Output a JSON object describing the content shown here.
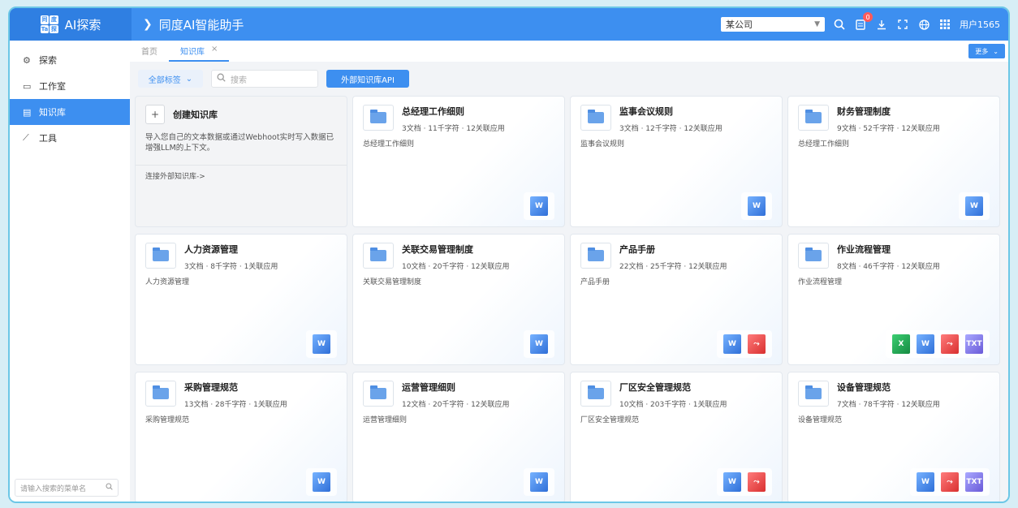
{
  "header": {
    "brand": "AI探索",
    "breadcrumb": "同度AI智能助手",
    "company": "某公司",
    "notification_count": "0",
    "user": "用户1565",
    "icons": [
      "search-icon",
      "notification-icon",
      "download-icon",
      "fullscreen-icon",
      "globe-icon",
      "grid-icon"
    ]
  },
  "sidebar": {
    "items": [
      {
        "label": "探索",
        "icon": "explore-icon"
      },
      {
        "label": "工作室",
        "icon": "monitor-icon"
      },
      {
        "label": "知识库",
        "icon": "book-icon"
      },
      {
        "label": "工具",
        "icon": "tool-icon"
      }
    ],
    "search_placeholder": "请输入搜索的菜单名"
  },
  "tabs": {
    "home": "首页",
    "active": "知识库",
    "more": "更多"
  },
  "toolbar": {
    "tag_filter": "全部标签",
    "search_placeholder": "搜索",
    "api_button": "外部知识库API"
  },
  "create_card": {
    "title": "创建知识库",
    "description": "导入您自己的文本数据或通过Webhoot实时写入数据已增强LLM的上下文。",
    "link": "连接外部知识库->"
  },
  "cards": [
    {
      "title": "总经理工作细则",
      "meta": "3文档 · 11千字符 · 12关联应用",
      "desc": "总经理工作细则",
      "files": [
        "word"
      ]
    },
    {
      "title": "监事会议规则",
      "meta": "3文档 · 12千字符 · 12关联应用",
      "desc": "监事会议规则",
      "files": [
        "word"
      ]
    },
    {
      "title": "财务管理制度",
      "meta": "9文档 · 52千字符 · 12关联应用",
      "desc": "总经理工作细则",
      "files": [
        "word"
      ]
    },
    {
      "title": "人力资源管理",
      "meta": "3文档 · 8千字符 · 1关联应用",
      "desc": "人力资源管理",
      "files": [
        "word"
      ]
    },
    {
      "title": "关联交易管理制度",
      "meta": "10文档 · 20千字符 · 12关联应用",
      "desc": "关联交易管理制度",
      "files": [
        "word"
      ]
    },
    {
      "title": "产品手册",
      "meta": "22文档 · 25千字符 · 12关联应用",
      "desc": "产品手册",
      "files": [
        "word",
        "pdf"
      ]
    },
    {
      "title": "作业流程管理",
      "meta": "8文档 · 46千字符 · 12关联应用",
      "desc": "作业流程管理",
      "files": [
        "excel",
        "word",
        "pdf",
        "txt"
      ]
    },
    {
      "title": "采购管理规范",
      "meta": "13文档 · 28千字符 · 1关联应用",
      "desc": "采购管理规范",
      "files": [
        "word"
      ]
    },
    {
      "title": "运营管理细则",
      "meta": "12文档 · 20千字符 · 12关联应用",
      "desc": "运营管理细则",
      "files": [
        "word"
      ]
    },
    {
      "title": "厂区安全管理规范",
      "meta": "10文档 · 203千字符 · 1关联应用",
      "desc": "厂区安全管理规范",
      "files": [
        "word",
        "pdf"
      ]
    },
    {
      "title": "设备管理规范",
      "meta": "7文档 · 78千字符 · 12关联应用",
      "desc": "设备管理规范",
      "files": [
        "word",
        "pdf",
        "txt"
      ]
    }
  ]
}
